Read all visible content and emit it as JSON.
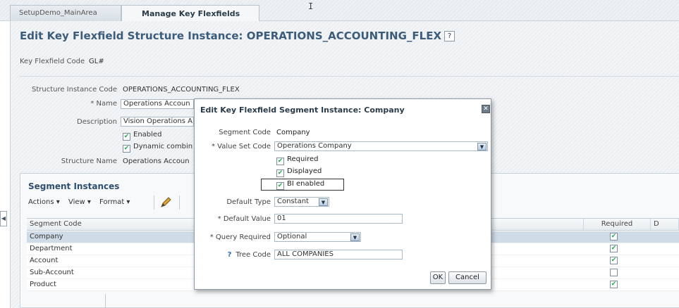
{
  "tabs": [
    "SetupDemo_MainArea",
    "Manage Key Flexfields"
  ],
  "page": {
    "title": "Edit Key Flexfield Structure Instance: OPERATIONS_ACCOUNTING_FLEX",
    "help_glyph": "?",
    "kff_code_label": "Key Flexfield Code",
    "kff_code_value": "GL#"
  },
  "form": {
    "sic_label": "Structure Instance Code",
    "sic_value": "OPERATIONS_ACCOUNTING_FLEX",
    "name_label": "* Name",
    "name_value": "Operations Accoun",
    "desc_label": "Description",
    "desc_value": "Vision Operations A",
    "enabled_label": "Enabled",
    "dynamic_label": "Dynamic combin",
    "structure_name_label": "Structure Name",
    "structure_name_value": "Operations Accoun"
  },
  "segments": {
    "title": "Segment Instances",
    "toolbar": {
      "actions": "Actions ▾",
      "view": "View ▾",
      "format": "Format ▾"
    },
    "columns": {
      "segment_code": "Segment Code",
      "required": "Required",
      "d": "D"
    },
    "rows": [
      {
        "code": "Company",
        "required": true
      },
      {
        "code": "Department",
        "required": true
      },
      {
        "code": "Account",
        "required": true
      },
      {
        "code": "Sub-Account",
        "required": false
      },
      {
        "code": "Product",
        "required": true
      }
    ]
  },
  "dialog": {
    "title": "Edit Key Flexfield Segment Instance: Company",
    "segment_code_label": "Segment Code",
    "segment_code_value": "Company",
    "value_set_label": "* Value Set Code",
    "value_set_value": "Operations Company",
    "required_label": "Required",
    "displayed_label": "Displayed",
    "bi_enabled_label": "BI enabled",
    "default_type_label": "Default Type",
    "default_type_value": "Constant",
    "default_value_label": "* Default Value",
    "default_value_value": "01",
    "query_required_label": "* Query Required",
    "query_required_value": "Optional",
    "tree_code_label": "Tree Code",
    "tree_code_value": "ALL COMPANIES",
    "ok_label": "OK",
    "cancel_label": "Cancel"
  },
  "icons": [
    "close-icon",
    "help-icon",
    "edit-pencil-icon",
    "checkbox-checked-icon",
    "dropdown-arrow-icon",
    "collapse-left-icon",
    "text-cursor-icon"
  ]
}
